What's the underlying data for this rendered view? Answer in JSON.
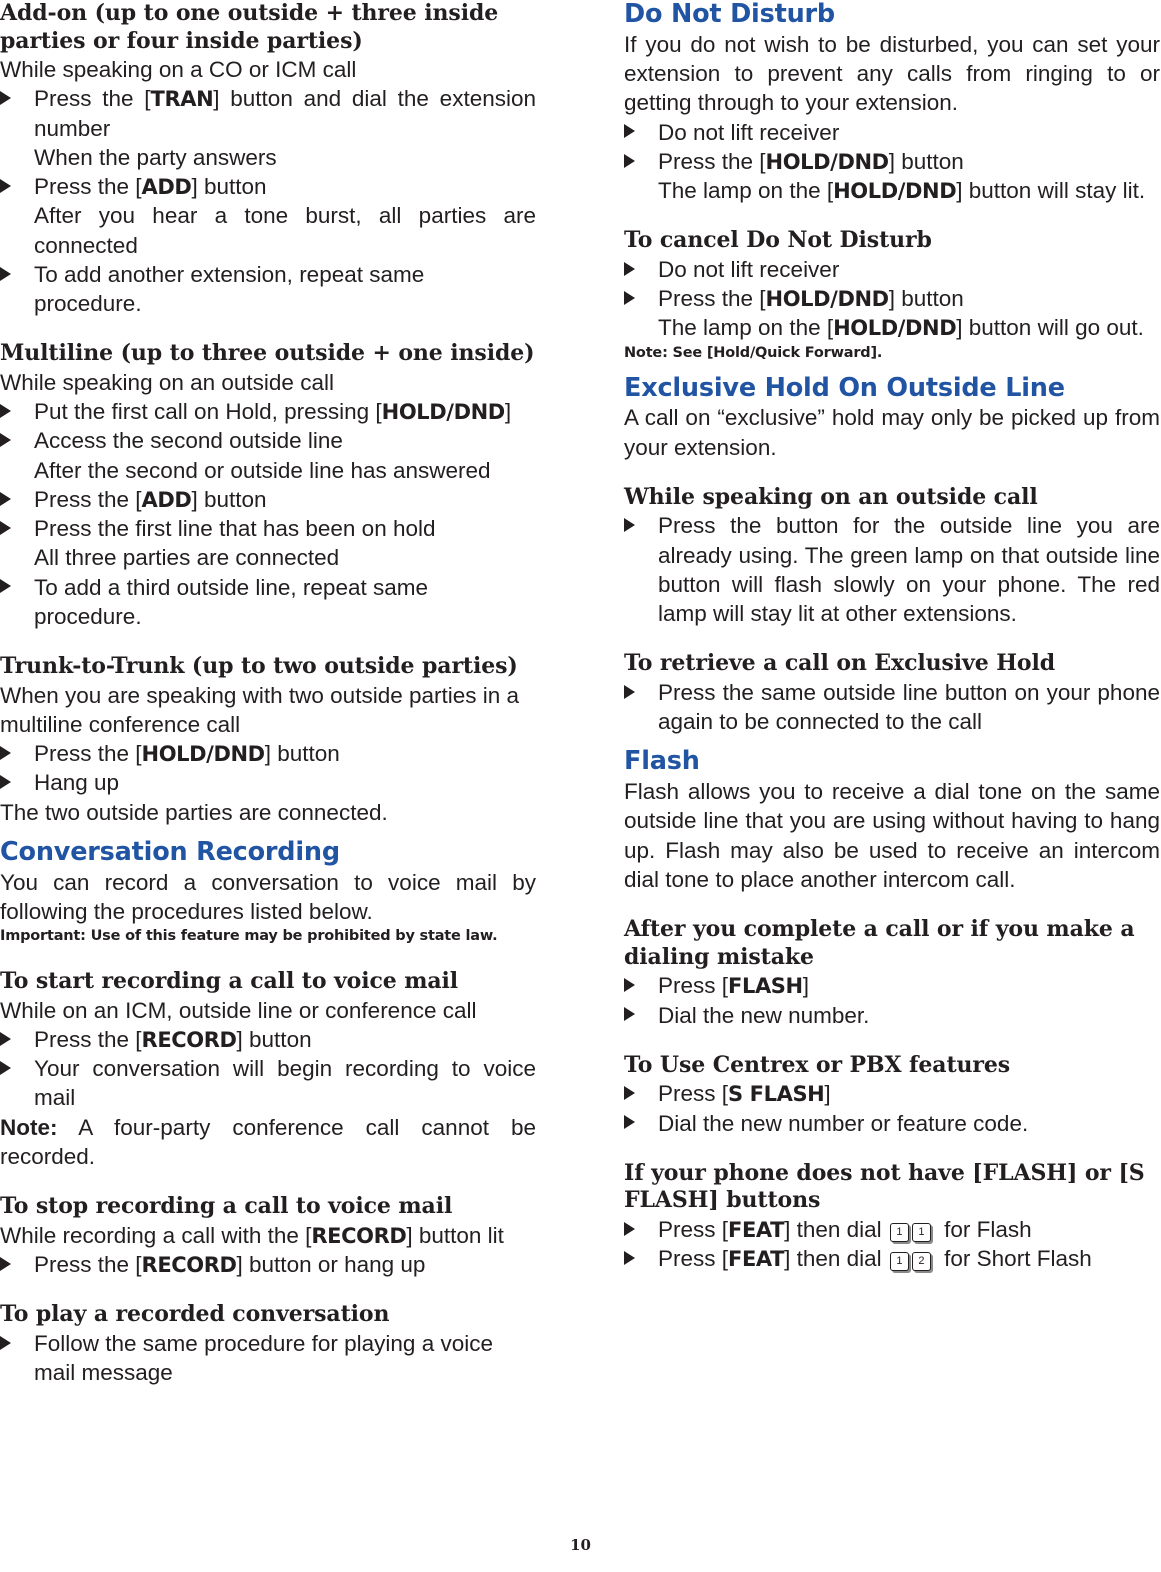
{
  "page": {
    "number": "10",
    "accent_color": "#2155a3",
    "text_color": "#231f20"
  },
  "left_column": {
    "addon": {
      "heading": "Add-on (up to one outside + three inside parties or four inside parties)",
      "intro": "While speaking on a CO or ICM call",
      "b1_pre": "Press the [",
      "b1_key": "TRAN",
      "b1_post": "] button and dial the extension number",
      "b1_cont": "When the party answers",
      "b2_pre": "Press the [",
      "b2_key": "ADD",
      "b2_post": "] button",
      "b2_cont": "After you hear a tone burst, all parties are connected",
      "b3": "To add another extension, repeat same procedure."
    },
    "multiline": {
      "heading": "Multiline (up to three outside + one inside)",
      "intro": "While speaking on an outside call",
      "b1_pre": "Put the first call on Hold, pressing [",
      "b1_key": "HOLD/DND",
      "b1_post": "]",
      "b2": "Access the second outside line",
      "b2_cont": "After the second or outside line has answered",
      "b3_pre": "Press the [",
      "b3_key": "ADD",
      "b3_post": "] button",
      "b4": "Press the first line that has been on hold",
      "b4_cont": "All three parties are connected",
      "b5": "To add a third outside line, repeat same procedure."
    },
    "trunk": {
      "heading": "Trunk-to-Trunk (up to two outside parties)",
      "intro": "When you are speaking with two outside parties in a multiline conference call",
      "b1_pre": "Press the [",
      "b1_key": "HOLD/DND",
      "b1_post": "] button",
      "b2": "Hang up",
      "closing": "The two outside parties are connected."
    },
    "conversation_recording": {
      "heading": "Conversation Recording",
      "intro": "You can record a conversation to voice mail by following the procedures listed below.",
      "important": "Important: Use of this feature may be prohibited by state law.",
      "start": {
        "heading": "To start recording a call to voice mail",
        "intro": "While on an ICM, outside line or conference call",
        "b1_pre": "Press the [",
        "b1_key": "RECORD",
        "b1_post": "]  button",
        "b2": "Your conversation will begin recording to voice mail",
        "note_label": "Note:",
        "note_text": "  A four-party conference call cannot be recorded."
      },
      "stop": {
        "heading": "To stop recording a call to voice mail",
        "intro_pre": "While recording a call with the [",
        "intro_key": "RECORD",
        "intro_post": "] button lit",
        "b1_pre": "Press the [",
        "b1_key": "RECORD",
        "b1_post": "] button or hang up"
      },
      "play": {
        "heading": "To play a recorded conversation",
        "b1": "Follow the same procedure for playing a voice mail message"
      }
    }
  },
  "right_column": {
    "do_not_disturb": {
      "heading": "Do Not Disturb",
      "intro": "If you do not wish to be disturbed, you can set your extension to prevent any calls from ringing to or getting through to your extension.",
      "b1": "Do not lift receiver",
      "b2_pre": "Press the [",
      "b2_key": "HOLD/DND",
      "b2_post": "] button",
      "b2_cont_pre": "The lamp on the [",
      "b2_cont_key": "HOLD/DND",
      "b2_cont_post": "] button will stay lit.",
      "cancel": {
        "heading": "To cancel Do Not Disturb",
        "b1": "Do not lift receiver",
        "b2_pre": "Press the [",
        "b2_key": "HOLD/DND",
        "b2_post": "] button",
        "b2_cont_pre": "The lamp on the [",
        "b2_cont_key": "HOLD/DND",
        "b2_cont_post": "] button  will go out.",
        "note": "Note: See [Hold/Quick Forward]."
      }
    },
    "exclusive_hold": {
      "heading": "Exclusive Hold On Outside Line",
      "intro": "A call on “exclusive” hold may only be picked up from your extension.",
      "while_speaking": {
        "heading": "While speaking on an outside call",
        "b1": "Press the button for the outside line you are already using. The green lamp on that outside line button will flash slowly on your phone. The red lamp will stay lit at other extensions."
      },
      "retrieve": {
        "heading": "To retrieve a call on Exclusive Hold",
        "b1": "Press the same outside line button on your phone again to be connected to the call"
      }
    },
    "flash": {
      "heading": "Flash",
      "intro": "Flash allows you to receive a dial tone on the same outside line that you are using without having to hang up.  Flash may also be used to receive an intercom dial tone to place another intercom call.",
      "after_call": {
        "heading": "After you complete a call or if you make a dialing mistake",
        "b1_pre": "Press [",
        "b1_key": "FLASH",
        "b1_post": "]",
        "b2": "Dial the new number."
      },
      "centrex": {
        "heading": "To Use Centrex or PBX features",
        "b1_pre": "Press [",
        "b1_key": "S FLASH",
        "b1_post": "]",
        "b2": "Dial the new number or feature code."
      },
      "no_flash": {
        "heading_pre": "If your phone does not have [",
        "heading_key1": "FLASH",
        "heading_mid": "] or [",
        "heading_key2": "S FLASH",
        "heading_post": "] buttons",
        "b1_pre": "Press [",
        "b1_key": "FEAT",
        "b1_mid": "] then dial ",
        "b1_digit1": "1",
        "b1_digit2": "1",
        "b1_post": " for Flash",
        "b2_pre": "Press [",
        "b2_key": "FEAT",
        "b2_mid": "] then dial ",
        "b2_digit1": "1",
        "b2_digit2": "2",
        "b2_post": "  for Short Flash"
      }
    }
  }
}
